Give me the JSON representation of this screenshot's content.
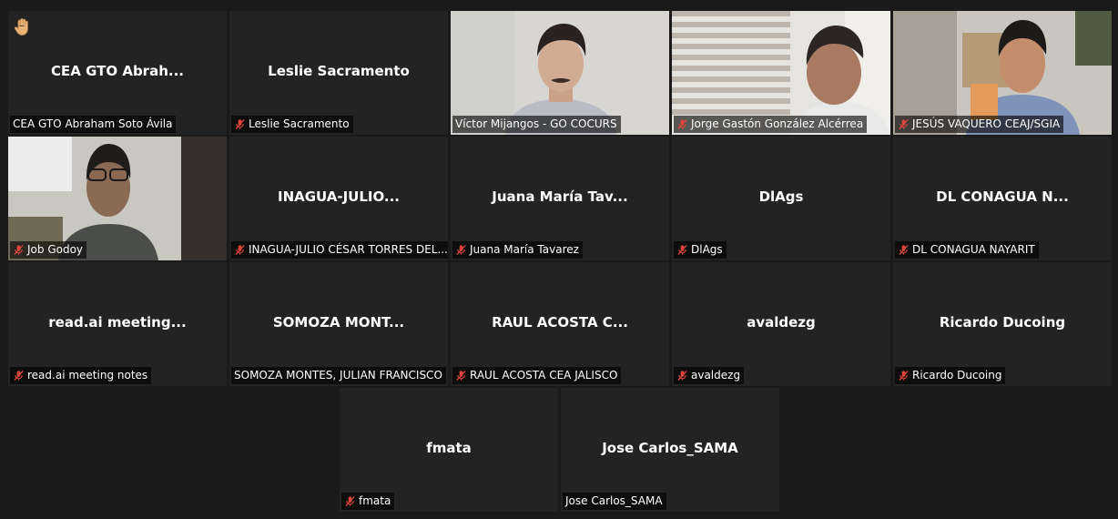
{
  "colors": {
    "tile_bg": "#232323",
    "active_border": "#c9e36b",
    "mute_icon": "#e0453a"
  },
  "participants": [
    {
      "display": "CEA GTO  Abrah...",
      "label": "CEA GTO  Abraham Soto Ávila",
      "muted": false,
      "hand_raised": true
    },
    {
      "display": "Leslie Sacramento",
      "label": "Leslie Sacramento",
      "muted": true
    },
    {
      "label": "Víctor Mijangos - GO COCURS",
      "muted": false,
      "video": true,
      "active_speaker": true
    },
    {
      "label": "Jorge Gastón González Alcérrea",
      "muted": true,
      "video": true
    },
    {
      "label": "JESÚS VAQUERO CEAJ/SGIA",
      "muted": true,
      "video": true
    },
    {
      "label": "Job Godoy",
      "muted": true,
      "video": true
    },
    {
      "display": "INAGUA-JULIO...",
      "label": "INAGUA-JULIO CÉSAR TORRES DEL...",
      "muted": true
    },
    {
      "display": "Juana María Tav...",
      "label": "Juana María Tavarez",
      "muted": true
    },
    {
      "display": "DlAgs",
      "label": "DlAgs",
      "muted": true
    },
    {
      "display": "DL CONAGUA N...",
      "label": "DL CONAGUA NAYARIT",
      "muted": true
    },
    {
      "display": "read.ai  meeting...",
      "label": "read.ai meeting notes",
      "muted": true
    },
    {
      "display": "SOMOZA  MONT...",
      "label": "SOMOZA MONTES, JULIAN FRANCISCO",
      "muted": false
    },
    {
      "display": "RAUL  ACOSTA  C...",
      "label": "RAUL ACOSTA CEA JALISCO",
      "muted": true
    },
    {
      "display": "avaldezg",
      "label": "avaldezg",
      "muted": true
    },
    {
      "display": "Ricardo Ducoing",
      "label": "Ricardo Ducoing",
      "muted": true
    },
    {
      "display": "fmata",
      "label": "fmata",
      "muted": true
    },
    {
      "display": "Jose Carlos_SAMA",
      "label": "Jose Carlos_SAMA",
      "muted": false
    }
  ]
}
